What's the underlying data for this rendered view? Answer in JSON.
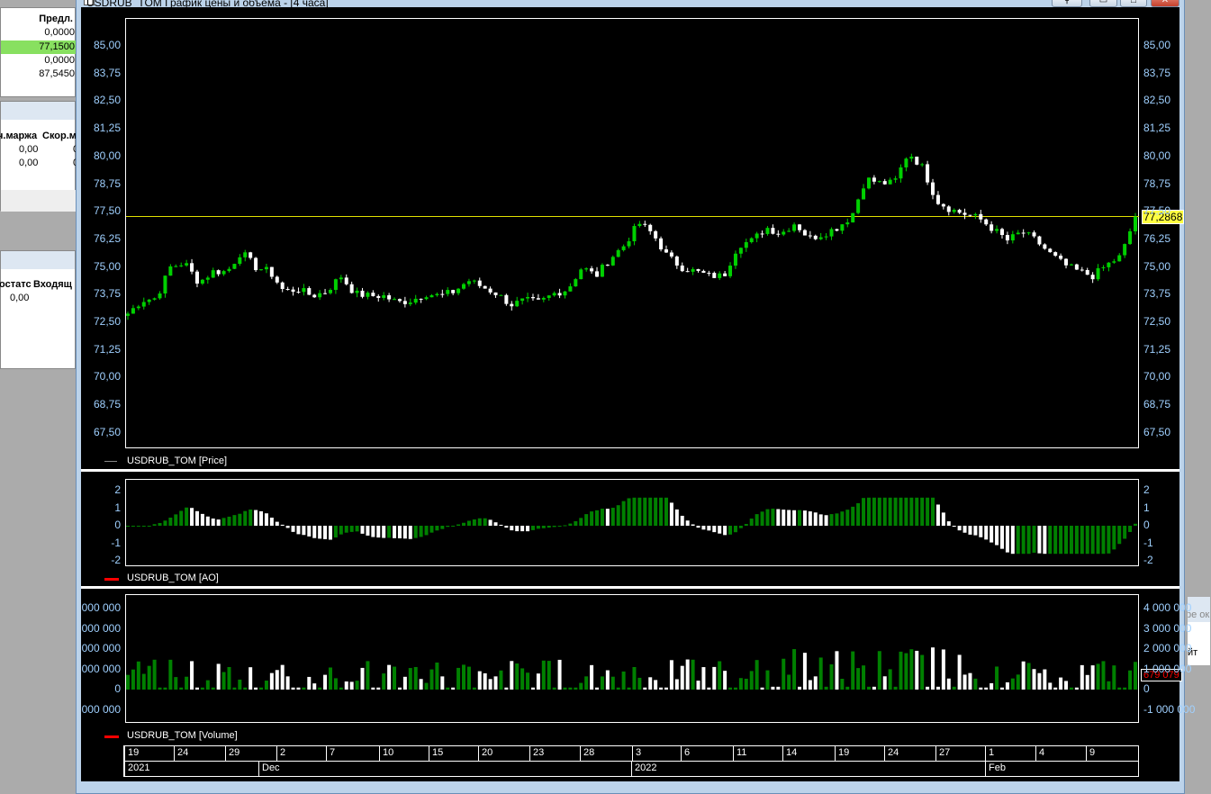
{
  "background_app": {
    "table1": {
      "header": "Предл.",
      "values": [
        "0,0000",
        "77,1500",
        "0,0000",
        "87,5450"
      ]
    },
    "table2": {
      "headers": [
        "ч.маржа",
        "Скор.м"
      ],
      "rows": [
        [
          "0,00",
          "0"
        ],
        [
          "0,00",
          "0"
        ]
      ]
    },
    "table3": {
      "headers": [
        "остатс",
        "Входящ"
      ],
      "rows": [
        [
          "0,00"
        ]
      ]
    },
    "dialog_fragment": {
      "line1": "ре ок",
      "line2": "йт"
    }
  },
  "window": {
    "title": "USDRUB_TOM График цены и объема - [4 часа]",
    "buttons": {
      "pin": "⚲",
      "minimize": "▭",
      "maximize": "□",
      "close": "✕"
    }
  },
  "colors": {
    "up": "#00d000",
    "down": "#ffffff",
    "volume_up": "#008000",
    "last_line": "#e0e000",
    "axis_label": "#9fd0ff"
  },
  "chart_data": [
    {
      "type": "candlestick",
      "legend": "USDRUB_TOM [Price]",
      "ylim": [
        67.5,
        85.0
      ],
      "y_ticks": [
        "85,00",
        "83,75",
        "82,50",
        "81,25",
        "80,00",
        "78,75",
        "77,50",
        "76,25",
        "75,00",
        "73,75",
        "72,50",
        "71,25",
        "70,00",
        "68,75",
        "67,50"
      ],
      "last_price": 77.2868,
      "last_price_label": "77,2868",
      "close_path": [
        72.9,
        73.5,
        73.6,
        75.0,
        75.2,
        74.3,
        74.8,
        74.8,
        75.7,
        75.0,
        74.8,
        73.9,
        74.0,
        73.7,
        73.9,
        74.6,
        73.8,
        73.7,
        73.7,
        73.4,
        73.5,
        73.8,
        73.7,
        73.9,
        74.4,
        74.1,
        73.8,
        73.3,
        73.5,
        73.4,
        73.8,
        74.0,
        75.0,
        74.6,
        75.4,
        76.0,
        77.0,
        76.5,
        75.5,
        75.0,
        74.8,
        74.6,
        74.6,
        76.0,
        76.2,
        76.8,
        76.5,
        77.0,
        76.3,
        76.5,
        76.8,
        77.3,
        79.0,
        78.8,
        78.8,
        80.2,
        79.5,
        78.0,
        77.6,
        77.4,
        77.2,
        76.7,
        76.2,
        76.6,
        76.2,
        75.6,
        75.1,
        74.8,
        74.6,
        75.1,
        75.5,
        77.29
      ]
    },
    {
      "type": "bar",
      "legend": "USDRUB_TOM [AO]",
      "ylim": [
        -2,
        2
      ],
      "y_ticks": [
        "2",
        "1",
        "0",
        "-1",
        "-2"
      ]
    },
    {
      "type": "bar",
      "legend": "USDRUB_TOM [Volume]",
      "ylim": [
        -1000000,
        4000000
      ],
      "y_ticks_left": [
        "000 000",
        "000 000",
        "000 000",
        "000 000",
        "0",
        "000 000"
      ],
      "y_ticks_right": [
        "4 000 000",
        "3 000 000",
        "2 000 000",
        "1 000 000",
        "0",
        "-1 000 000"
      ],
      "last_volume_label": "679 079"
    }
  ],
  "time_axis": {
    "days": [
      "19",
      "24",
      "29",
      "2",
      "7",
      "10",
      "15",
      "20",
      "23",
      "28",
      "3",
      "6",
      "11",
      "14",
      "19",
      "24",
      "27",
      "1",
      "4",
      "9"
    ],
    "periods": [
      "2021",
      "Dec",
      "2022",
      "Feb"
    ]
  }
}
